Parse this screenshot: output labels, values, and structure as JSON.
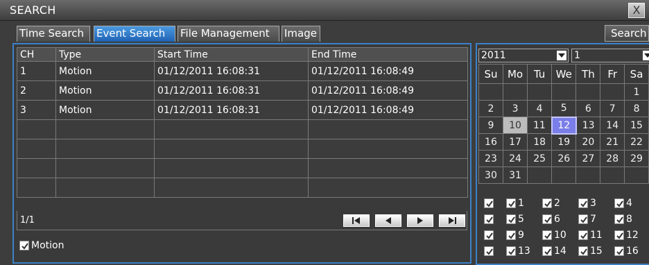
{
  "window": {
    "title": "SEARCH",
    "close": "X"
  },
  "tabs": [
    "Time Search",
    "Event Search",
    "File Management",
    "Image"
  ],
  "active_tab": 1,
  "search_button": "Search",
  "table": {
    "headers": [
      "CH",
      "Type",
      "Start Time",
      "End Time"
    ],
    "rows": [
      [
        "1",
        "Motion",
        "01/12/2011 16:08:31",
        "01/12/2011 16:08:49"
      ],
      [
        "2",
        "Motion",
        "01/12/2011 16:08:31",
        "01/12/2011 16:08:49"
      ],
      [
        "3",
        "Motion",
        "01/12/2011 16:08:31",
        "01/12/2011 16:08:49"
      ],
      [
        "",
        "",
        "",
        ""
      ],
      [
        "",
        "",
        "",
        ""
      ],
      [
        "",
        "",
        "",
        ""
      ],
      [
        "",
        "",
        "",
        ""
      ]
    ]
  },
  "pager": {
    "page": "1/1"
  },
  "motion_filter": {
    "label": "Motion",
    "checked": true
  },
  "calendar": {
    "year": "2011",
    "month": "1",
    "weekdays": [
      "Su",
      "Mo",
      "Tu",
      "We",
      "Th",
      "Fr",
      "Sa"
    ],
    "weeks": [
      [
        "",
        "",
        "",
        "",
        "",
        "",
        "1"
      ],
      [
        "2",
        "3",
        "4",
        "5",
        "6",
        "7",
        "8"
      ],
      [
        "9",
        "10",
        "11",
        "12",
        "13",
        "14",
        "15"
      ],
      [
        "16",
        "17",
        "18",
        "19",
        "20",
        "21",
        "22"
      ],
      [
        "23",
        "24",
        "25",
        "26",
        "27",
        "28",
        "29"
      ],
      [
        "30",
        "31",
        "",
        "",
        "",
        "",
        ""
      ]
    ],
    "highlighted_day": "10",
    "selected_day": "12"
  },
  "channels": [
    [
      "1",
      "2",
      "3",
      "4"
    ],
    [
      "5",
      "6",
      "7",
      "8"
    ],
    [
      "9",
      "10",
      "11",
      "12"
    ],
    [
      "13",
      "14",
      "15",
      "16"
    ]
  ]
}
